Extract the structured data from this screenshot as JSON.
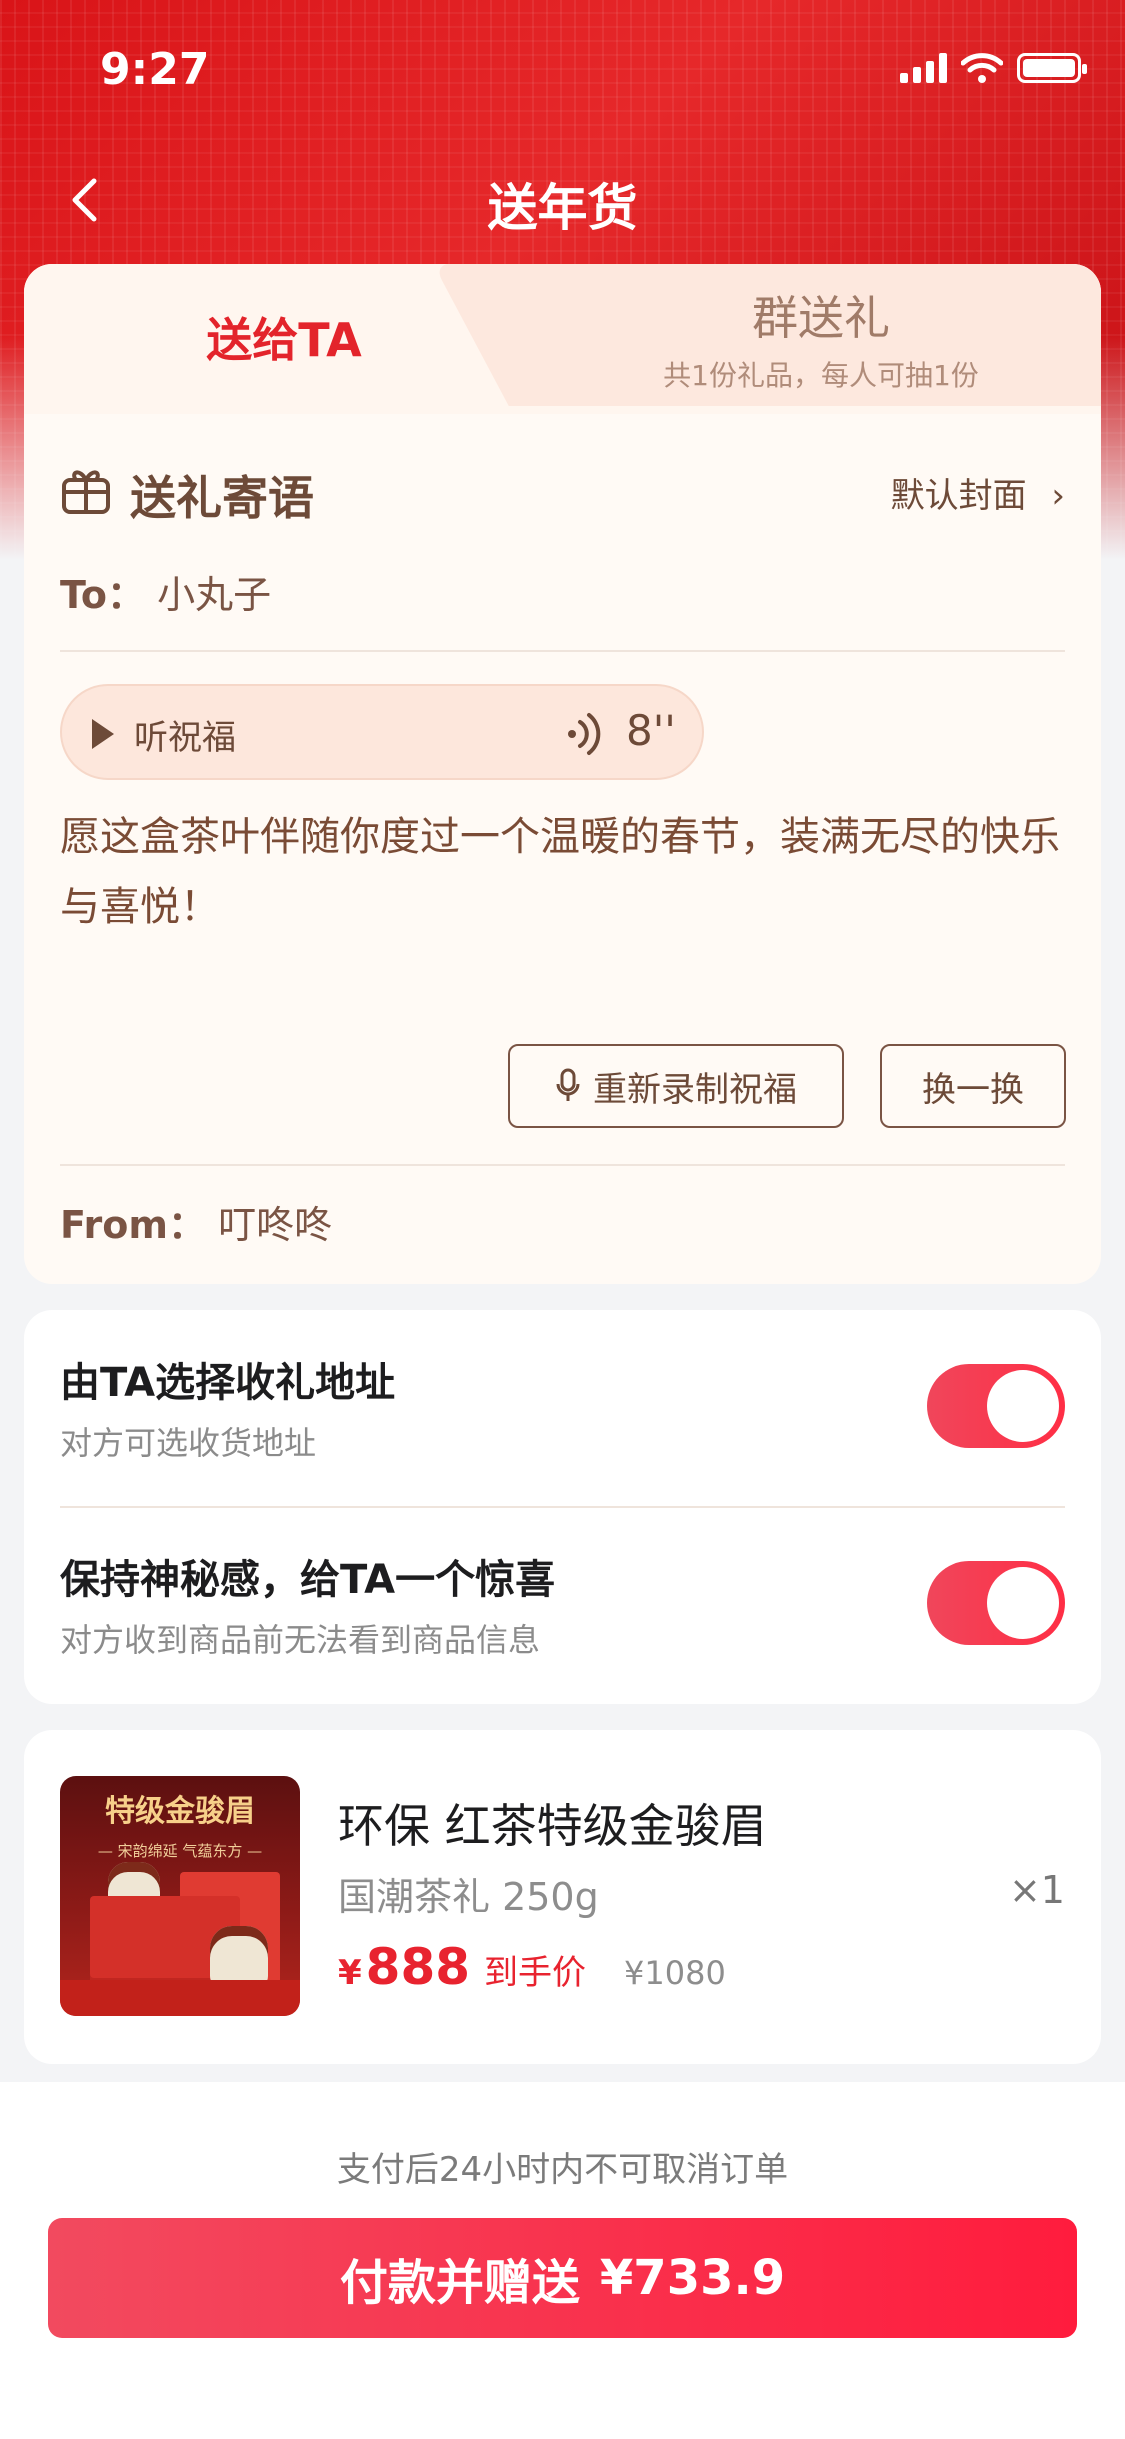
{
  "status_bar": {
    "time": "9:27"
  },
  "nav": {
    "title": "送年货"
  },
  "tabs": {
    "active_label": "送给TA",
    "group_label": "群送礼",
    "group_sub": "共1份礼品，每人可抽1份"
  },
  "message": {
    "title": "送礼寄语",
    "cover_label": "默认封面",
    "to_label": "To：",
    "to_name": "小丸子",
    "voice_label": "听祝福",
    "voice_duration": "8''",
    "text": "愿这盒茶叶伴随你度过一个温暖的春节，装满无尽的快乐与喜悦！",
    "rerecord_label": "重新录制祝福",
    "change_label": "换一换",
    "from_label": "From：",
    "from_name": "叮咚咚"
  },
  "options": [
    {
      "title": "由TA选择收礼地址",
      "subtitle": "对方可选收货地址",
      "on": true
    },
    {
      "title": "保持神秘感，给TA一个惊喜",
      "subtitle": "对方收到商品前无法看到商品信息",
      "on": true
    }
  ],
  "product": {
    "image_title": "特级金骏眉",
    "image_subtitle": "— 宋韵绵延 气蕴东方 —",
    "name": "环保 红茶特级金骏眉",
    "spec": "国潮茶礼 250g",
    "qty": "×1",
    "price_currency": "¥",
    "price": "888",
    "price_tag": "到手价",
    "original_price": "¥1080"
  },
  "footer": {
    "notice": "支付后24小时内不可取消订单",
    "pay_label": "付款并赠送",
    "pay_amount": "¥733.9"
  },
  "colors": {
    "brand_red": "#e3242b",
    "toggle_on": "#ff2e45"
  }
}
